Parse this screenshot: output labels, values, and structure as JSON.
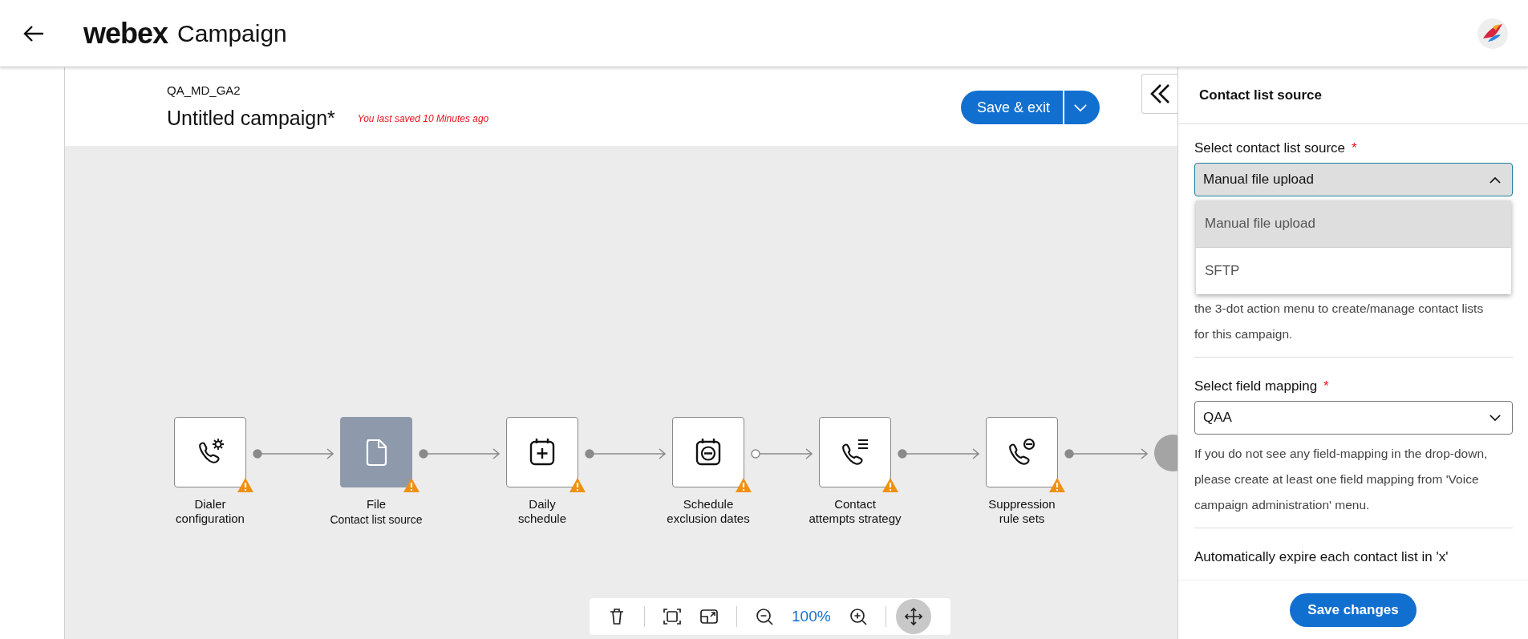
{
  "header": {
    "logo": "webex",
    "app_name": "Campaign"
  },
  "campaign": {
    "folder": "QA_MD_GA2",
    "title": "Untitled campaign*",
    "save_status": "You last saved 10 Minutes ago",
    "save_button": "Save & exit"
  },
  "flow": {
    "nodes": [
      {
        "kind": "dialer",
        "title_lines": [
          "Dialer",
          "configuration"
        ],
        "selected": false,
        "warning": true,
        "connector_hollow": false
      },
      {
        "kind": "file",
        "title_lines": [
          "File"
        ],
        "subtitle": "Contact list source",
        "selected": true,
        "warning": true,
        "connector_hollow": false
      },
      {
        "kind": "calendar-add",
        "title_lines": [
          "Daily",
          "schedule"
        ],
        "selected": false,
        "warning": true,
        "connector_hollow": false
      },
      {
        "kind": "calendar-remove",
        "title_lines": [
          "Schedule",
          "exclusion dates"
        ],
        "selected": false,
        "warning": true,
        "connector_hollow": true
      },
      {
        "kind": "phone-list",
        "title_lines": [
          "Contact",
          "attempts strategy"
        ],
        "selected": false,
        "warning": true,
        "connector_hollow": false
      },
      {
        "kind": "phone-block",
        "title_lines": [
          "Suppression",
          "rule sets"
        ],
        "selected": false,
        "warning": true,
        "connector_hollow": false
      }
    ]
  },
  "toolbar": {
    "zoom": "100%",
    "pan_active": true
  },
  "panel": {
    "title": "Contact list source",
    "source": {
      "label": "Select contact list source",
      "required_mark": "*",
      "value": "Manual file upload",
      "expanded": true,
      "options": [
        {
          "label": "Manual file upload",
          "selected": true
        },
        {
          "label": "SFTP",
          "selected": false
        }
      ]
    },
    "source_help": "the 3-dot action menu to create/manage contact lists for this campaign.",
    "mapping": {
      "label": "Select field mapping",
      "required_mark": "*",
      "value": "QAA",
      "expanded": false
    },
    "mapping_help": "If you do not see any field-mapping in the drop-down, please create at least one field mapping from 'Voice campaign administration' menu.",
    "expire_label": "Automatically expire each contact list in 'x'",
    "save_button": "Save changes"
  }
}
